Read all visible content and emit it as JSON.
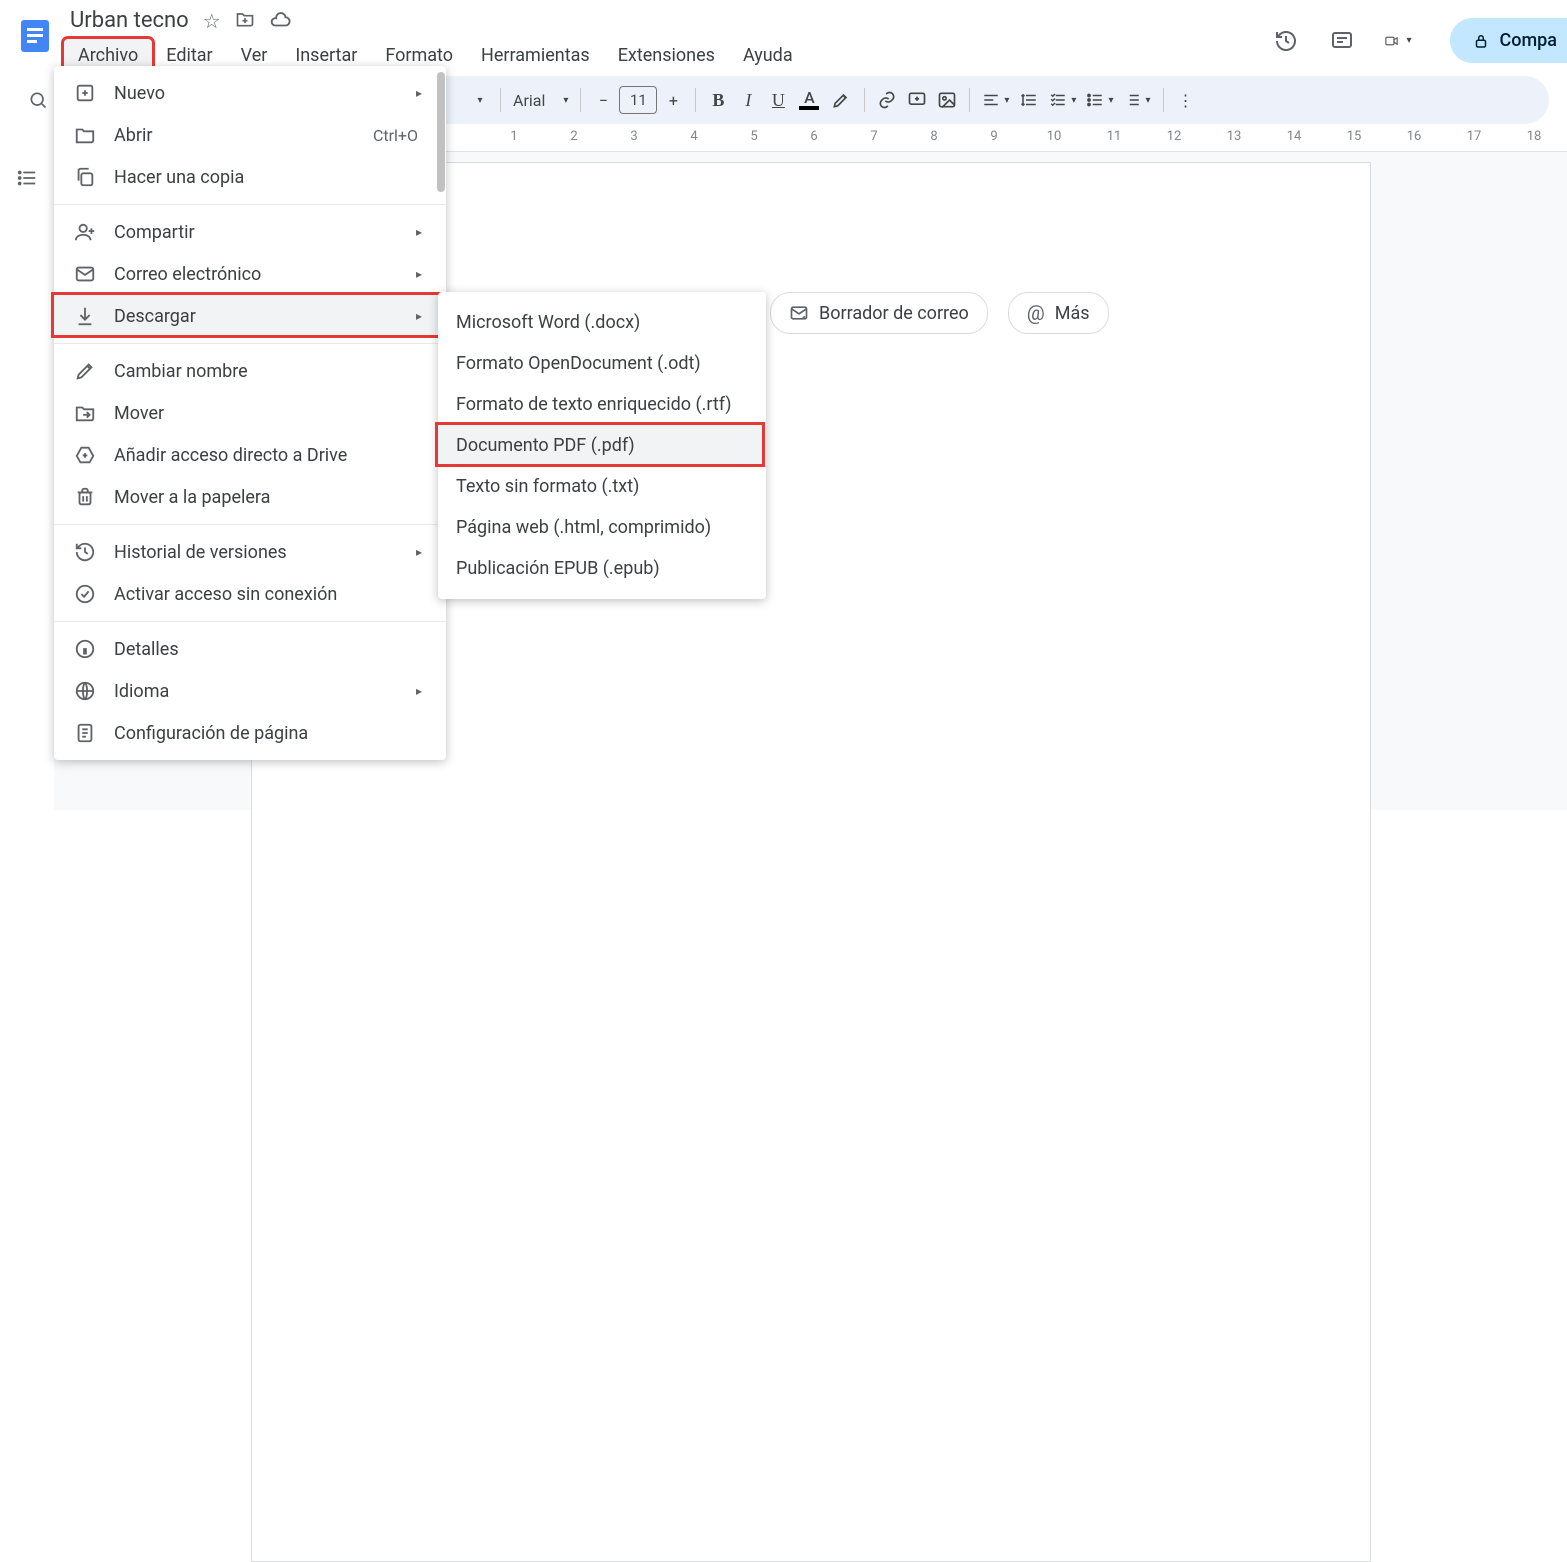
{
  "header": {
    "doc_title": "Urban tecno",
    "share_label": "Compa"
  },
  "menubar": {
    "items": [
      "Archivo",
      "Editar",
      "Ver",
      "Insertar",
      "Formato",
      "Herramientas",
      "Extensiones",
      "Ayuda"
    ],
    "active_index": 0
  },
  "toolbar": {
    "font_name": "Arial",
    "font_size": "11"
  },
  "ruler": {
    "numbers": [
      "1",
      "2",
      "3",
      "4",
      "5",
      "6",
      "7",
      "8",
      "9",
      "10",
      "11",
      "12",
      "13",
      "14",
      "15",
      "16",
      "17",
      "18"
    ]
  },
  "chips": {
    "draft_email": "Borrador de correo",
    "more": "Más"
  },
  "dropdown": {
    "items": [
      {
        "icon": "plus-box",
        "label": "Nuevo",
        "caret": true
      },
      {
        "icon": "folder",
        "label": "Abrir",
        "shortcut": "Ctrl+O"
      },
      {
        "icon": "copy",
        "label": "Hacer una copia"
      },
      {
        "sep": true
      },
      {
        "icon": "person-add",
        "label": "Compartir",
        "caret": true
      },
      {
        "icon": "mail",
        "label": "Correo electrónico",
        "caret": true
      },
      {
        "icon": "download",
        "label": "Descargar",
        "caret": true,
        "hover": true,
        "box": true
      },
      {
        "sep": true
      },
      {
        "icon": "rename",
        "label": "Cambiar nombre"
      },
      {
        "icon": "move",
        "label": "Mover"
      },
      {
        "icon": "drive-add",
        "label": "Añadir acceso directo a Drive"
      },
      {
        "icon": "trash",
        "label": "Mover a la papelera"
      },
      {
        "sep": true
      },
      {
        "icon": "history",
        "label": "Historial de versiones",
        "caret": true
      },
      {
        "icon": "offline",
        "label": "Activar acceso sin conexión"
      },
      {
        "sep": true
      },
      {
        "icon": "info",
        "label": "Detalles"
      },
      {
        "icon": "globe",
        "label": "Idioma",
        "caret": true
      },
      {
        "icon": "page",
        "label": "Configuración de página"
      }
    ]
  },
  "submenu": {
    "items": [
      {
        "label": "Microsoft Word (.docx)"
      },
      {
        "label": "Formato OpenDocument (.odt)"
      },
      {
        "label": "Formato de texto enriquecido (.rtf)"
      },
      {
        "label": "Documento PDF (.pdf)",
        "hover": true,
        "box": true
      },
      {
        "label": "Texto sin formato (.txt)"
      },
      {
        "label": "Página web (.html, comprimido)"
      },
      {
        "label": "Publicación EPUB (.epub)"
      }
    ]
  }
}
